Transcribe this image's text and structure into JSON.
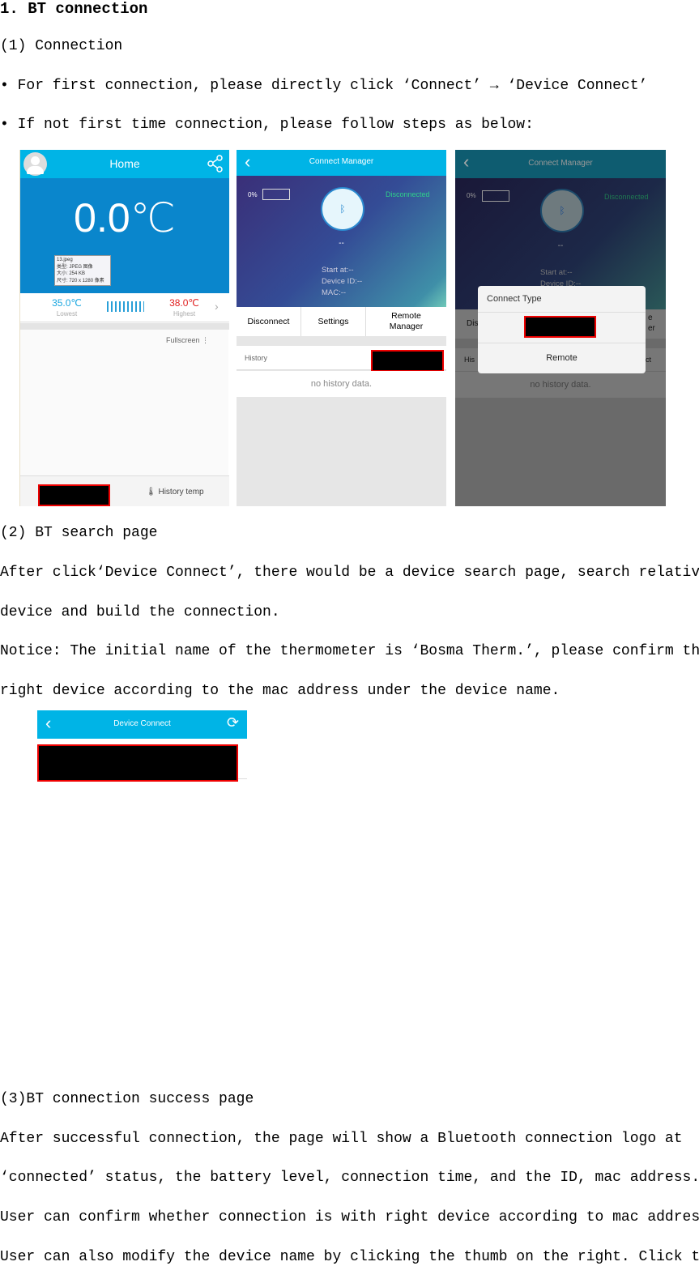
{
  "section_title": "1. BT connection",
  "sub1": "(1) Connection",
  "bullet1": "•   For first connection, please directly click ‘Connect’ → ‘Device Connect’",
  "bullet2": "•   If not first time connection, please follow steps as below:",
  "home": {
    "title": "Home",
    "temp": "0.0℃",
    "tooltip": [
      "13.jpeg",
      "类型: JPEG 图像",
      "大小: 254 KB",
      "尺寸: 720 x 1280 像素"
    ],
    "lowest_val": "35.0℃",
    "lowest_label": "Lowest",
    "highest_val": "38.0℃",
    "highest_label": "Highest",
    "fullscreen": "Fullscreen",
    "history_temp": "History temp",
    "colors": {
      "header": "#00b4e6",
      "body": "#0a86cc",
      "low": "#1aa6e0",
      "high": "#e02020"
    }
  },
  "cm": {
    "title": "Connect Manager",
    "battery": "0%",
    "status": "Disconnected",
    "name": "--",
    "start": "Start at:--",
    "device_id": "Device ID:--",
    "mac": "MAC:--",
    "buttons": [
      "Disconnect",
      "Settings",
      "Remote Manager"
    ],
    "history": "History",
    "no_history": "no history data."
  },
  "dialog": {
    "title": "Connect Type",
    "remote": "Remote",
    "behind_left": "Dis",
    "behind_right1": "e",
    "behind_right2": "er",
    "behind_hist": "His",
    "behind_conn": "ect"
  },
  "sub2": "(2) BT search page",
  "p2a": "After click‘Device Connect’, there would be a device search page, search relative",
  "p2b": "device and build the connection.",
  "p2c": "Notice: The initial name of the thermometer is ‘Bosma Therm.’, please confirm the",
  "p2d": "right device according to the mac address under the device name.",
  "dc": {
    "title": "Device Connect"
  },
  "sub3": "(3)BT connection success page",
  "p3a": "After successful connection, the page will show a Bluetooth connection logo at",
  "p3b": "‘connected’ status, the battery level, connection time, and the ID, mac address.",
  "p3c": "User can confirm whether connection is with right device according to mac address.",
  "p3d": "User can also modify the device name by clicking the thumb on the right. Click the"
}
